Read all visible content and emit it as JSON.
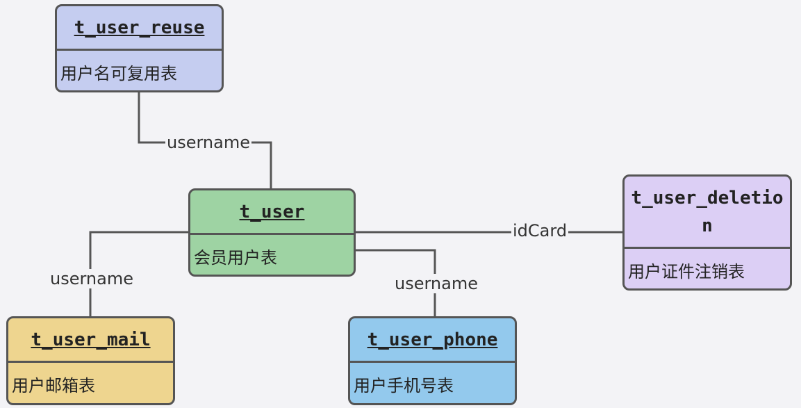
{
  "colors": {
    "background": "#f3f3f6",
    "edge": "#555555",
    "t_user": "#9ed3a3",
    "t_user_reuse": "#c5cdf0",
    "t_user_mail": "#eed58f",
    "t_user_phone": "#93c9ed",
    "t_user_deletion": "#dccff5"
  },
  "entities": {
    "t_user": {
      "name": "t_user",
      "description": "会员用户表"
    },
    "t_user_reuse": {
      "name": "t_user_reuse",
      "description": "用户名可复用表"
    },
    "t_user_mail": {
      "name": "t_user_mail",
      "description": "用户邮箱表"
    },
    "t_user_phone": {
      "name": "t_user_phone",
      "description": "用户手机号表"
    },
    "t_user_deletion": {
      "name": "t_user_deletion",
      "description": "用户证件注销表"
    }
  },
  "relations": {
    "reuse": {
      "label": "username"
    },
    "mail": {
      "label": "username"
    },
    "phone": {
      "label": "username"
    },
    "deletion": {
      "label": "idCard"
    }
  }
}
